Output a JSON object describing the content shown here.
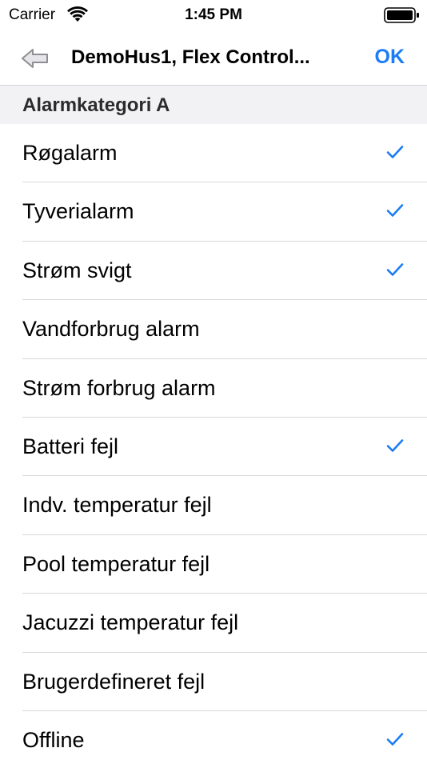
{
  "status_bar": {
    "carrier": "Carrier",
    "time": "1:45 PM"
  },
  "nav": {
    "title": "DemoHus1, Flex Control...",
    "ok_label": "OK",
    "back_icon": "back-arrow-icon"
  },
  "section": {
    "title": "Alarmkategori A"
  },
  "colors": {
    "accent": "#1a7cf6",
    "section_bg": "#f2f2f4",
    "separator": "#d9d9dc"
  },
  "items": [
    {
      "label": "Røgalarm",
      "checked": true
    },
    {
      "label": "Tyverialarm",
      "checked": true
    },
    {
      "label": "Strøm svigt",
      "checked": true
    },
    {
      "label": "Vandforbrug alarm",
      "checked": false
    },
    {
      "label": "Strøm forbrug alarm",
      "checked": false
    },
    {
      "label": "Batteri fejl",
      "checked": true
    },
    {
      "label": "Indv. temperatur fejl",
      "checked": false
    },
    {
      "label": "Pool temperatur fejl",
      "checked": false
    },
    {
      "label": "Jacuzzi temperatur fejl",
      "checked": false
    },
    {
      "label": "Brugerdefineret fejl",
      "checked": false
    },
    {
      "label": "Offline",
      "checked": true
    }
  ]
}
